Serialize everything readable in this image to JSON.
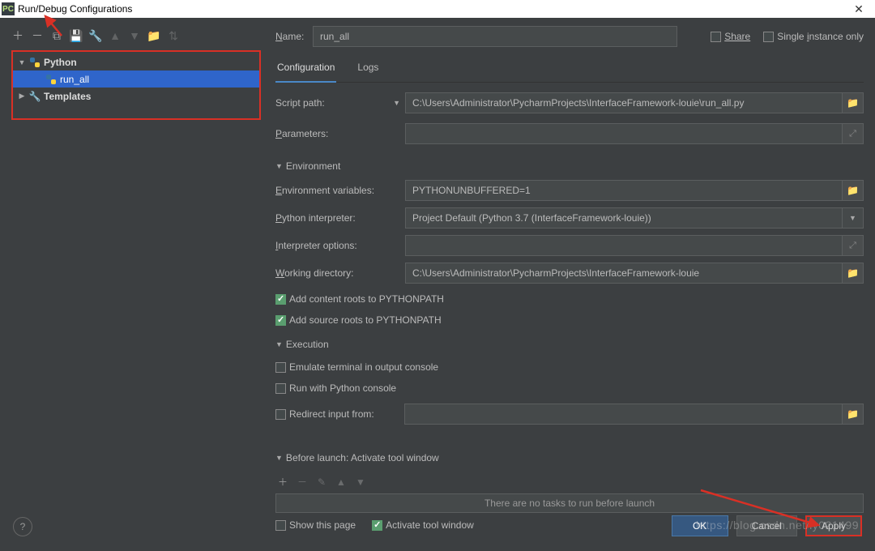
{
  "window": {
    "title": "Run/Debug Configurations"
  },
  "tree": {
    "python_label": "Python",
    "run_all_label": "run_all",
    "templates_label": "Templates"
  },
  "name_row": {
    "label_pre": "N",
    "label_rest": "ame:",
    "value": "run_all",
    "share": "Share",
    "single": "Single instance only"
  },
  "tabs": {
    "config": "Configuration",
    "logs": "Logs"
  },
  "fields": {
    "script_path_label": "Script path:",
    "script_path_value": "C:\\Users\\Administrator\\PycharmProjects\\InterfaceFramework-louie\\run_all.py",
    "parameters_pre": "P",
    "parameters_rest": "arameters:",
    "env_section": "Environment",
    "env_vars_pre": "E",
    "env_vars_rest": "nvironment variables:",
    "env_vars_value": "PYTHONUNBUFFERED=1",
    "py_interp_pre": "P",
    "py_interp_rest": "ython interpreter:",
    "py_interp_value": "Project Default (Python 3.7 (InterfaceFramework-louie))",
    "interp_opts_pre": "I",
    "interp_opts_rest": "nterpreter options:",
    "work_dir_pre": "W",
    "work_dir_rest": "orking directory:",
    "work_dir_value": "C:\\Users\\Administrator\\PycharmProjects\\InterfaceFramework-louie",
    "add_content_roots": "Add content roots to PYTHONPATH",
    "add_source_roots": "Add source roots to PYTHONPATH",
    "exec_section": "Execution",
    "emulate_terminal": "Emulate terminal in output console",
    "run_py_console": "Run with Python console",
    "redirect_input": "Redirect input from:",
    "before_launch_pre": "B",
    "before_launch_rest": "efore launch: Activate tool window",
    "no_tasks": "There are no tasks to run before launch",
    "show_this_page": "Show this page",
    "activate_tool": "Activate tool window"
  },
  "buttons": {
    "ok": "OK",
    "cancel": "Cancel",
    "apply": "Apply"
  },
  "watermark": "https://blog.csdn.net/ly021499"
}
